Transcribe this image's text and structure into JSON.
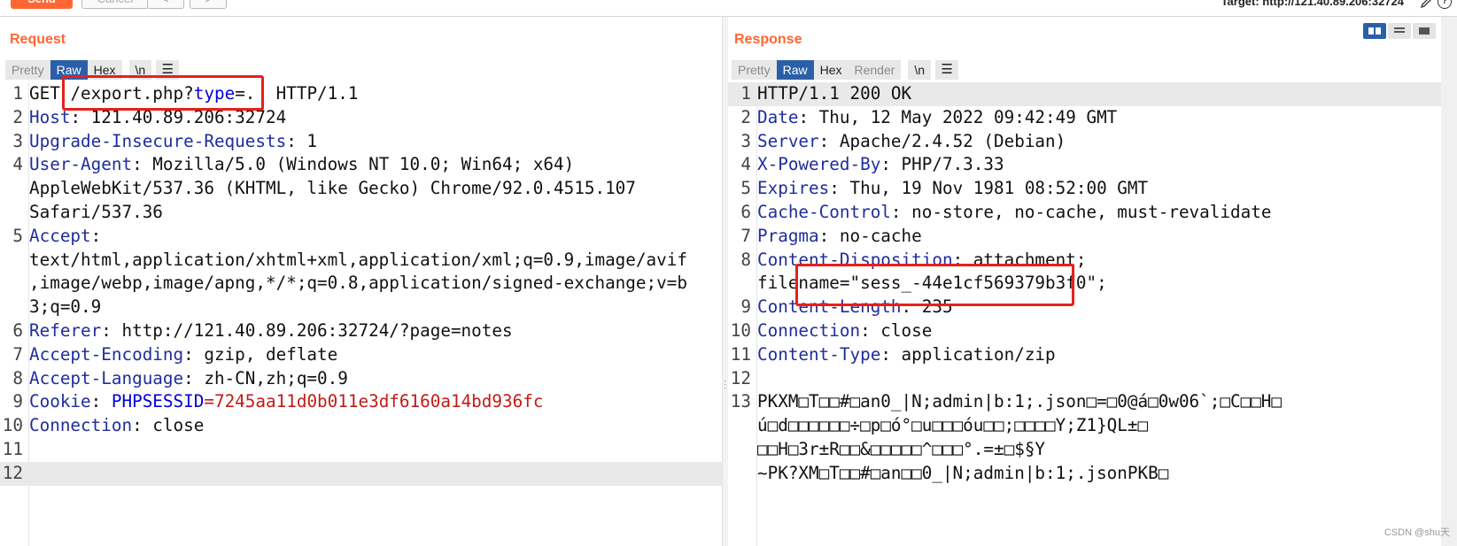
{
  "toolbar": {
    "send_label": "Send",
    "cancel_label": "Cancel",
    "back_label": "<",
    "forward_label": ">",
    "target": "Target: http://121.40.89.206:32724"
  },
  "request": {
    "title": "Request",
    "tabs": [
      "Pretty",
      "Raw",
      "Hex",
      "\\n"
    ],
    "active_tab": "Raw",
    "lines": [
      {
        "num": "1",
        "method": "GET ",
        "path": "/export.php?",
        "param_key": "type",
        "param_eq": "=.",
        "rest": "  HTTP/1.1"
      },
      {
        "num": "2",
        "key": "Host",
        "value": ": 121.40.89.206:32724"
      },
      {
        "num": "3",
        "key": "Upgrade-Insecure-Requests",
        "value": ": 1"
      },
      {
        "num": "4",
        "key": "User-Agent",
        "value": ": Mozilla/5.0 (Windows NT 10.0; Win64; x64)"
      },
      {
        "num": "",
        "value": "AppleWebKit/537.36 (KHTML, like Gecko) Chrome/92.0.4515.107"
      },
      {
        "num": "",
        "value": "Safari/537.36"
      },
      {
        "num": "5",
        "key": "Accept",
        "value": ":"
      },
      {
        "num": "",
        "value": "text/html,application/xhtml+xml,application/xml;q=0.9,image/avif"
      },
      {
        "num": "",
        "value": ",image/webp,image/apng,*/*;q=0.8,application/signed-exchange;v=b"
      },
      {
        "num": "",
        "value": "3;q=0.9"
      },
      {
        "num": "6",
        "key": "Referer",
        "value": ": http://121.40.89.206:32724/?page=notes"
      },
      {
        "num": "7",
        "key": "Accept-Encoding",
        "value": ": gzip, deflate"
      },
      {
        "num": "8",
        "key": "Accept-Language",
        "value": ": zh-CN,zh;q=0.9"
      },
      {
        "num": "9",
        "key": "Cookie",
        "value": ": ",
        "cookie_name": "PHPSESSID",
        "cookie_eq": "=",
        "cookie_value": "7245aa11d0b011e3df6160a14bd936fc"
      },
      {
        "num": "10",
        "key": "Connection",
        "value": ": close"
      },
      {
        "num": "11",
        "value": ""
      },
      {
        "num": "12",
        "value": ""
      }
    ]
  },
  "response": {
    "title": "Response",
    "tabs": [
      "Pretty",
      "Raw",
      "Hex",
      "Render",
      "\\n"
    ],
    "active_tab": "Raw",
    "lines": [
      {
        "num": "1",
        "value": "HTTP/1.1 200 OK"
      },
      {
        "num": "2",
        "key": "Date",
        "value": ": Thu, 12 May 2022 09:42:49 GMT"
      },
      {
        "num": "3",
        "key": "Server",
        "value": ": Apache/2.4.52 (Debian)"
      },
      {
        "num": "4",
        "key": "X-Powered-By",
        "value": ": PHP/7.3.33"
      },
      {
        "num": "5",
        "key": "Expires",
        "value": ": Thu, 19 Nov 1981 08:52:00 GMT"
      },
      {
        "num": "6",
        "key": "Cache-Control",
        "value": ": no-store, no-cache, must-revalidate"
      },
      {
        "num": "7",
        "key": "Pragma",
        "value": ": no-cache"
      },
      {
        "num": "8",
        "key": "Content-Disposition",
        "value": ": attachment;"
      },
      {
        "num": "",
        "value": "filename=\"sess_-44e1cf569379b3f0\";"
      },
      {
        "num": "9",
        "key": "Content-Length",
        "value": ": 235"
      },
      {
        "num": "10",
        "key": "Connection",
        "value": ": close"
      },
      {
        "num": "11",
        "key": "Content-Type",
        "value": ": application/zip"
      },
      {
        "num": "12",
        "value": ""
      },
      {
        "num": "13",
        "value": "PKXM□T□□#□an0_|N;admin|b:1;.json□=□0@á□0w06`;□C□□H□"
      },
      {
        "num": "",
        "value": "ú□d□□□□□□÷□p□ó°□u□□□óu□□;□□□□Y;Z1}QL±□"
      },
      {
        "num": "",
        "value": "□□H□3r±R□□&□□□□□^□□□°.=±□$§Y"
      },
      {
        "num": "",
        "value": "~PK?XM□T□□#□an□□0_|N;admin|b:1;.jsonPKB□"
      }
    ]
  },
  "watermark": "CSDN @shu天",
  "colors": {
    "accent": "#ff6633",
    "active_tab": "#2b5fa8",
    "highlight_box": "#e8201b",
    "header_key": "#1f2d9c",
    "cookie_value": "#c41a16"
  }
}
